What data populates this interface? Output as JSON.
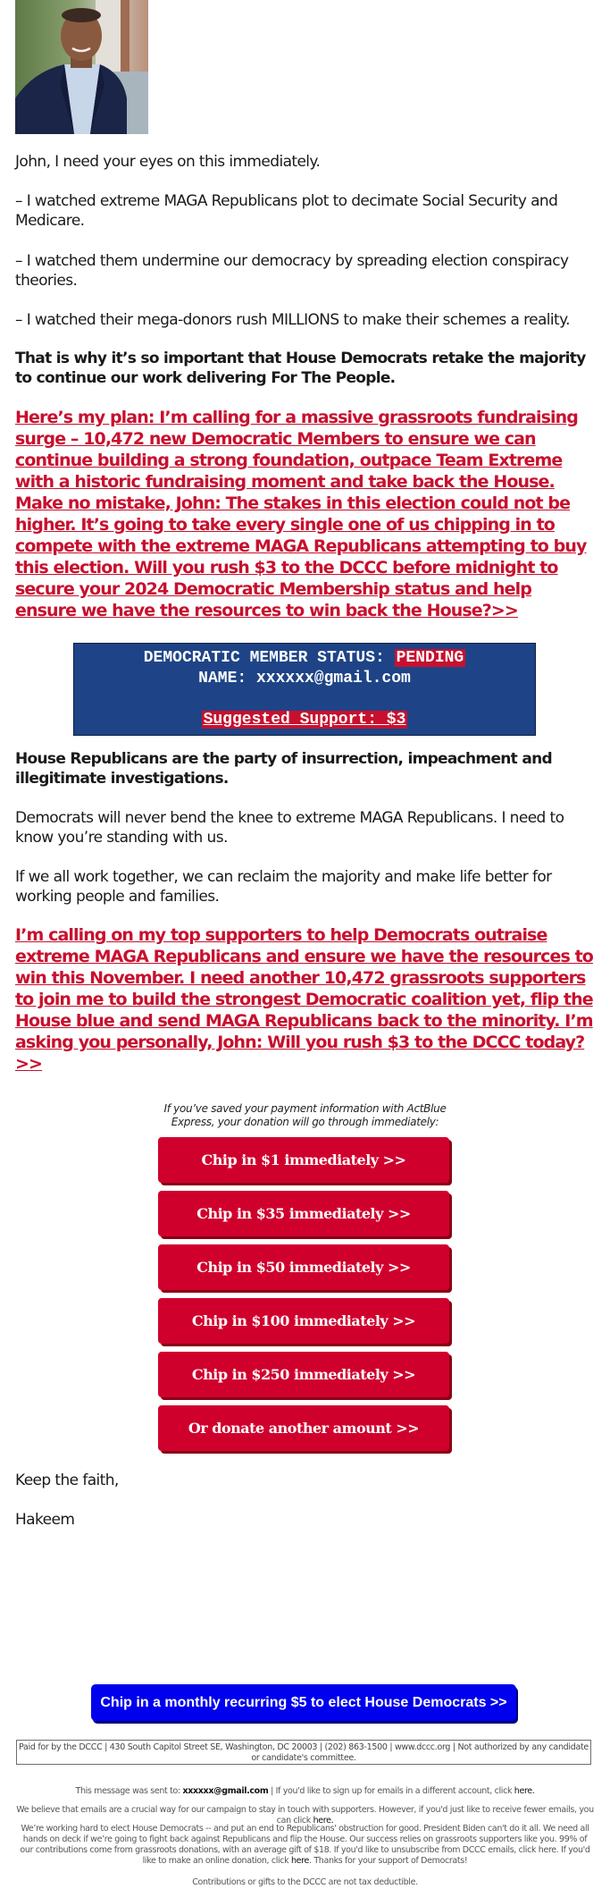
{
  "header": {
    "photo_alt": "Portrait of Hakeem Jeffries"
  },
  "body": {
    "greeting": "John, I need your eyes on this immediately.",
    "bullets": [
      "– I watched extreme MAGA Republicans plot to decimate Social Security and Medicare.",
      "– I watched them undermine our democracy by spreading election conspiracy theories.",
      "– I watched their mega-donors rush MILLIONS to make their schemes a reality."
    ],
    "bold_statement": "That is why it’s so important that House Democrats retake the majority to continue our work delivering For The People.",
    "plan_link": "Here’s my plan: I’m calling for a massive grassroots fundraising surge – 10,472 new Democratic Members to ensure we can continue building a strong foundation, outpace Team Extreme with a historic fundraising moment and take back the House. Make no mistake, John: The stakes in this election could not be higher. It’s going to take every single one of us chipping in to compete with the extreme MAGA Republicans attempting to buy this election. Will you rush $3 to the DCCC before midnight to secure your 2024 Democratic Membership status and help ensure we have the resources to win back the House?>>",
    "bold_statement_2": "House Republicans are the party of insurrection, impeachment and illegitimate investigations.",
    "para_1": "Democrats will never bend the knee to extreme MAGA Republicans. I need to know you’re standing with us.",
    "para_2": "If we all work together, we can reclaim the majority and make life better for working people and families.",
    "supporters_link": "I’m calling on my top supporters to help Democrats outraise extreme MAGA Republicans and ensure we have the resources to win this November. I need another 10,472 grassroots supporters to join me to build the strongest Democratic coalition yet, flip the House blue and send MAGA Republicans back to the minority. I’m asking you personally, John: Will you rush $3 to the DCCC today? >>",
    "closing": "Keep the faith,",
    "signature": "Hakeem"
  },
  "status_box": {
    "status_label": "DEMOCRATIC MEMBER STATUS:",
    "status_value": "PENDING",
    "name_label": "NAME:",
    "name_value": "xxxxxx@gmail.com",
    "suggested_support": "Suggested Support: $3"
  },
  "donation": {
    "note": "If you’ve saved your payment information with ActBlue Express, your donation will go through immediately:",
    "buttons": [
      "Chip in $1 immediately >>",
      "Chip in $35 immediately >>",
      "Chip in $50 immediately >>",
      "Chip in $100 immediately >>",
      "Chip in $250 immediately >>",
      "Or donate another amount >>"
    ],
    "recurring_button": "Chip in a monthly recurring $5 to elect House Democrats >>"
  },
  "footer": {
    "disclaimer": "Paid for by the DCCC | 430 South Capitol Street SE, Washington, DC 20003 | (202) 863-1500 | www.dccc.org | Not authorized by any candidate or candidate's committee.",
    "sent_to_prefix": "This message was sent to:",
    "sent_to_email": "xxxxxx@gmail.com",
    "sent_to_suffix": "| If you'd like to sign up for emails in a different account, click",
    "here": "here.",
    "fewer_emails": "We believe that emails are a crucial way for our campaign to stay in touch with supporters. However, if you'd just like to receive fewer emails, you can click",
    "working_hard": "We’re working hard to elect House Democrats -- and put an end to Republicans' obstruction for good. President Biden can't do it all. We need all hands on deck if we’re going to fight back against Republicans and flip the House. Our success relies on grassroots supporters like you. 99% of our contributions come from grassroots donations, with an average gift of $18. If you'd like to unsubscribe from DCCC emails, click here. If you'd like to make an online donation, click",
    "here_link": "here",
    "thanks": ". Thanks for your support of Democrats!",
    "tax": "Contributions or gifts to the DCCC are not tax deductible."
  },
  "colors": {
    "link_red": "#c8102e",
    "button_red": "#d0002d",
    "status_blue": "#1e4487",
    "recurring_blue": "#0000ee"
  }
}
